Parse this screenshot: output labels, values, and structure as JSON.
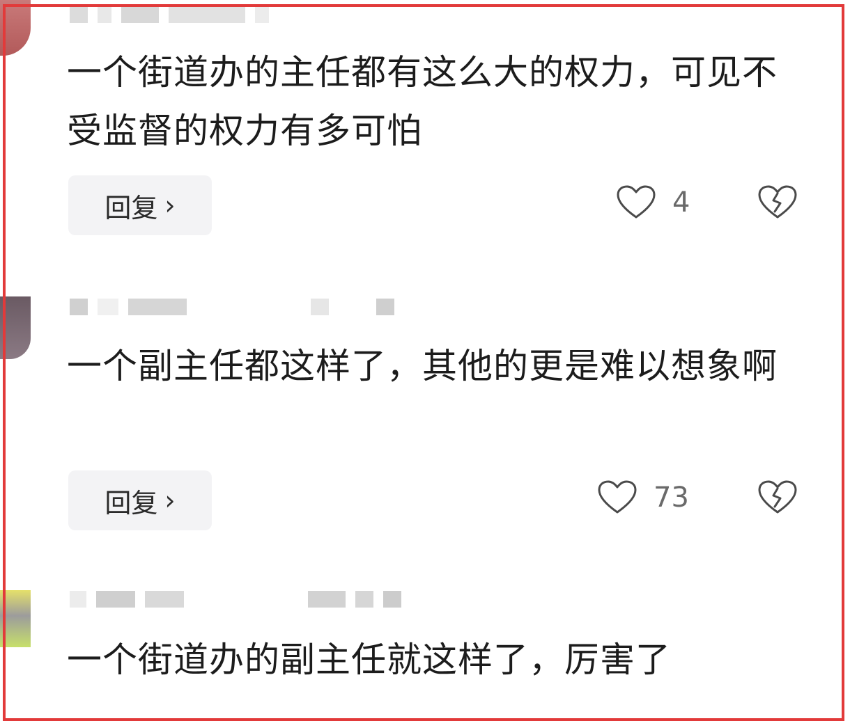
{
  "comments": [
    {
      "text": "一个街道办的主任都有这么大的权力，可见不受监督的权力有多可怕",
      "reply_label": "回复",
      "likes": "4"
    },
    {
      "text": "一个副主任都这样了，其他的更是难以想象啊",
      "reply_label": "回复",
      "likes": "73"
    },
    {
      "text": "一个街道办的副主任就这样了，厉害了"
    }
  ],
  "colors": {
    "frame": "#e23a3a",
    "reply_bg": "#f3f3f5",
    "text": "#1c1c1c",
    "muted": "#6a6a6a"
  },
  "icons": {
    "reply_chevron": "chevron-right-icon",
    "like": "heart-outline-icon",
    "dislike": "broken-heart-icon"
  }
}
